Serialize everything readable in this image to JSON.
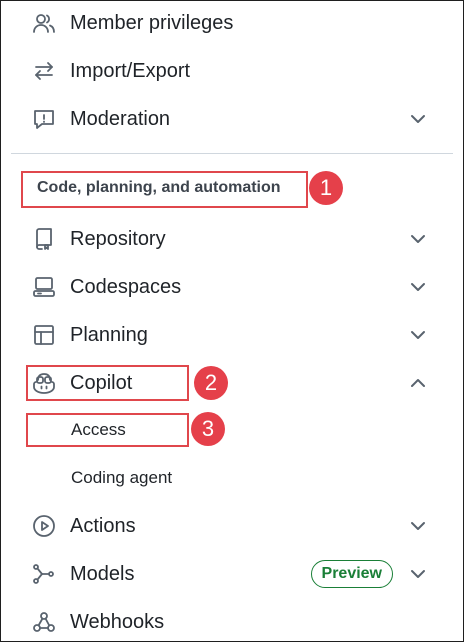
{
  "nav": {
    "member_privileges": "Member privileges",
    "import_export": "Import/Export",
    "moderation": "Moderation",
    "section_header": "Code, planning, and automation",
    "repository": "Repository",
    "codespaces": "Codespaces",
    "planning": "Planning",
    "copilot": "Copilot",
    "access": "Access",
    "coding_agent": "Coding agent",
    "actions": "Actions",
    "models": "Models",
    "preview_badge": "Preview",
    "webhooks": "Webhooks"
  },
  "callouts": {
    "one": "1",
    "two": "2",
    "three": "3"
  },
  "colors": {
    "highlight": "#e0474c",
    "callout_bg": "#e5404a",
    "preview_green": "#1a7f37"
  },
  "icons": {
    "member_privileges": "people-icon",
    "import_export": "arrow-switch-icon",
    "moderation": "report-icon",
    "repository": "repo-icon",
    "codespaces": "codespaces-icon",
    "planning": "table-icon",
    "copilot": "copilot-icon",
    "actions": "play-icon",
    "models": "ai-model-icon",
    "webhooks": "webhook-icon"
  }
}
